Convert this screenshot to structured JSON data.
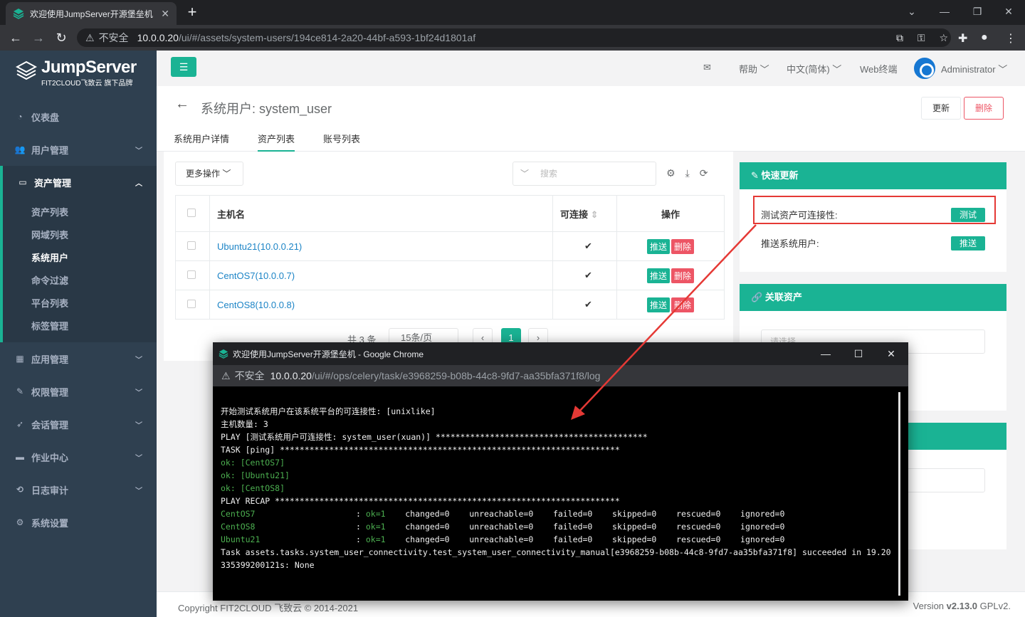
{
  "browser": {
    "tab_title": "欢迎使用JumpServer开源堡垒机",
    "insecure_label": "不安全",
    "url_host": "10.0.0.20",
    "url_path": "/ui/#/assets/system-users/194ce814-2a20-44bf-a593-1bf24d1801af"
  },
  "sidebar": {
    "logo_name": "JumpServer",
    "logo_sub": "FIT2CLOUD飞致云 旗下品牌",
    "items": [
      {
        "label": "仪表盘",
        "icon": "dashboard-icon"
      },
      {
        "label": "用户管理",
        "icon": "users-icon"
      },
      {
        "label": "资产管理",
        "icon": "inbox-icon"
      },
      {
        "label": "应用管理",
        "icon": "grid-icon"
      },
      {
        "label": "权限管理",
        "icon": "edit-icon"
      },
      {
        "label": "会话管理",
        "icon": "rocket-icon"
      },
      {
        "label": "作业中心",
        "icon": "terminal-icon"
      },
      {
        "label": "日志审计",
        "icon": "history-icon"
      },
      {
        "label": "系统设置",
        "icon": "gears-icon"
      }
    ],
    "asset_sub": [
      "资产列表",
      "网域列表",
      "系统用户",
      "命令过滤",
      "平台列表",
      "标签管理"
    ]
  },
  "topbar": {
    "help": "帮助",
    "language": "中文(简体)",
    "web_terminal": "Web终端",
    "user": "Administrator"
  },
  "page": {
    "title": "系统用户: system_user",
    "update_btn": "更新",
    "delete_btn": "删除",
    "tabs": [
      "系统用户详情",
      "资产列表",
      "账号列表"
    ]
  },
  "table": {
    "more_actions": "更多操作",
    "search_placeholder": "搜索",
    "headers": {
      "hostname": "主机名",
      "connectable": "可连接",
      "actions": "操作"
    },
    "rows": [
      {
        "host": "Ubuntu21(10.0.0.21)",
        "push": "推送",
        "delete": "删除"
      },
      {
        "host": "CentOS7(10.0.0.7)",
        "push": "推送",
        "delete": "删除"
      },
      {
        "host": "CentOS8(10.0.0.8)",
        "push": "推送",
        "delete": "删除"
      }
    ],
    "total": "共 3 条",
    "page_size": "15条/页",
    "page": "1"
  },
  "quick_update": {
    "title": "快速更新",
    "test_label": "测试资产可连接性:",
    "test_btn": "测试",
    "push_label": "推送系统用户:",
    "push_btn": "推送"
  },
  "related_assets": {
    "title": "关联资产",
    "select_placeholder": "请选择"
  },
  "footer": {
    "copyright": "Copyright FIT2CLOUD 飞致云 © 2014-2021",
    "version_prefix": "Version ",
    "version": "v2.13.0",
    "license": " GPLv2."
  },
  "popup": {
    "title": "欢迎使用JumpServer开源堡垒机 - Google Chrome",
    "insecure_label": "不安全",
    "url_host": "10.0.0.20",
    "url_path": "/ui/#/ops/celery/task/e3968259-b08b-44c8-9fd7-aa35bfa371f8/log",
    "log_lines": [
      {
        "text": "开始测试系统用户在该系统平台的可连接性: [unixlike]",
        "color": "white"
      },
      {
        "text": "主机数量: 3",
        "color": "white"
      },
      {
        "text": "PLAY [测试系统用户可连接性: system_user(xuan)] *******************************************",
        "color": "white"
      },
      {
        "text": "TASK [ping] *********************************************************************",
        "color": "white"
      },
      {
        "text": "ok: [CentOS7]",
        "color": "green"
      },
      {
        "text": "ok: [Ubuntu21]",
        "color": "green"
      },
      {
        "text": "ok: [CentOS8]",
        "color": "green"
      },
      {
        "text": "PLAY RECAP **********************************************************************",
        "color": "white"
      }
    ],
    "recap": [
      {
        "host": "CentOS7",
        "ok": "ok=1",
        "rest": "    changed=0    unreachable=0    failed=0    skipped=0    rescued=0    ignored=0"
      },
      {
        "host": "CentOS8",
        "ok": "ok=1",
        "rest": "    changed=0    unreachable=0    failed=0    skipped=0    rescued=0    ignored=0"
      },
      {
        "host": "Ubuntu21",
        "ok": "ok=1",
        "rest": "    changed=0    unreachable=0    failed=0    skipped=0    rescued=0    ignored=0"
      }
    ],
    "task_line1": "Task assets.tasks.system_user_connectivity.test_system_user_connectivity_manual[e3968259-b08b-44c8-9fd7-aa35bfa371f8] succeeded in 19.20",
    "task_line2": "335399200121s: None"
  },
  "colors": {
    "accent": "#1ab394",
    "danger": "#ed5565",
    "sidebar": "#2f4050",
    "annotation": "#e53935"
  }
}
